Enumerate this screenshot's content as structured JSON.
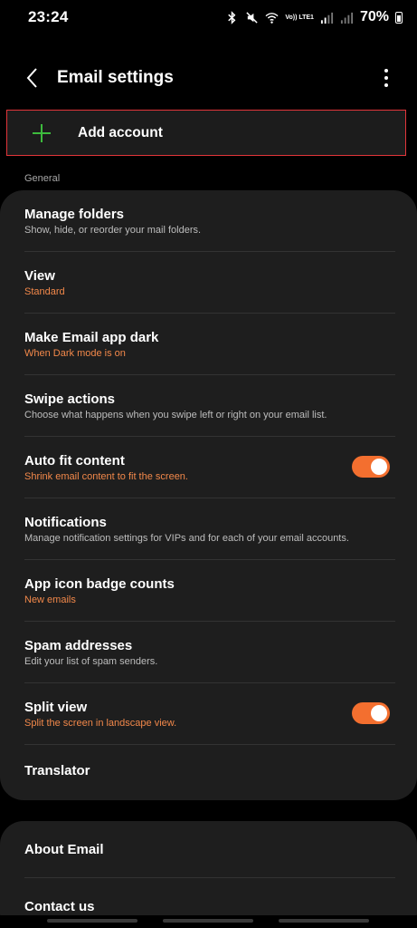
{
  "status_bar": {
    "time": "23:24",
    "network_label": "Vo)) LTE1",
    "battery": "70%"
  },
  "header": {
    "title": "Email settings",
    "back_icon": "chevron-left-icon",
    "more_icon": "more-vert-icon"
  },
  "add_account": {
    "label": "Add account",
    "icon": "plus-icon",
    "icon_color": "#3dbb3d",
    "highlight_color": "#e2353a"
  },
  "section_general": "General",
  "settings": [
    {
      "title": "Manage folders",
      "subtitle": "Show, hide, or reorder your mail folders.",
      "accent": false
    },
    {
      "title": "View",
      "subtitle": "Standard",
      "accent": true
    },
    {
      "title": "Make Email app dark",
      "subtitle": "When Dark mode is on",
      "accent": true
    },
    {
      "title": "Swipe actions",
      "subtitle": "Choose what happens when you swipe left or right on your email list.",
      "accent": false
    },
    {
      "title": "Auto fit content",
      "subtitle": "Shrink email content to fit the screen.",
      "accent": true,
      "toggle_on": true
    },
    {
      "title": "Notifications",
      "subtitle": "Manage notification settings for VIPs and for each of your email accounts.",
      "accent": false
    },
    {
      "title": "App icon badge counts",
      "subtitle": "New emails",
      "accent": true
    },
    {
      "title": "Spam addresses",
      "subtitle": "Edit your list of spam senders.",
      "accent": false
    },
    {
      "title": "Split view",
      "subtitle": "Split the screen in landscape view.",
      "accent": true,
      "toggle_on": true
    },
    {
      "title": "Translator"
    }
  ],
  "about_section": [
    {
      "title": "About Email"
    },
    {
      "title": "Contact us"
    }
  ],
  "colors": {
    "accent": "#f2884a",
    "toggle": "#f36f2f",
    "card_bg": "#1e1e1e"
  }
}
